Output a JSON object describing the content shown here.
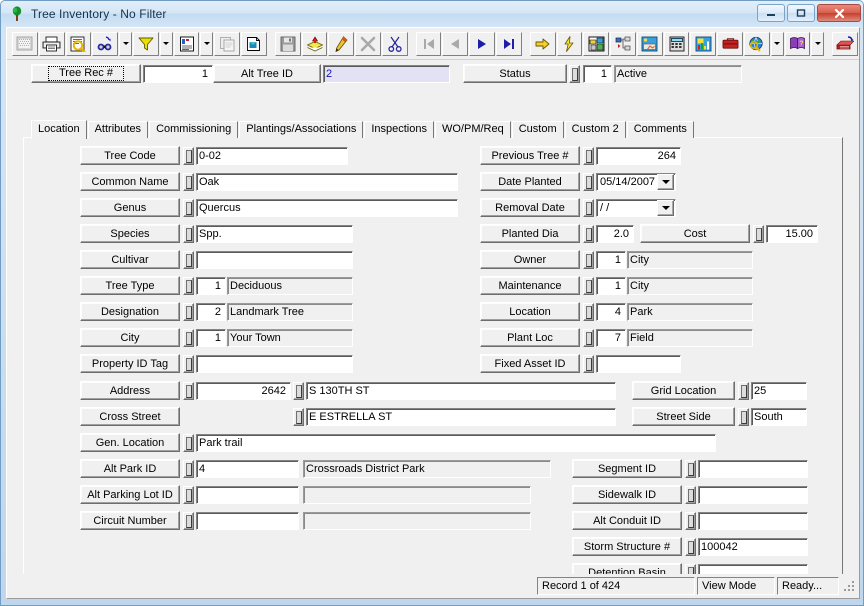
{
  "window": {
    "title": "Tree Inventory - No Filter",
    "icon": "tree-icon",
    "buttons": {
      "minimize": "minimize-icon",
      "maximize": "maximize-icon",
      "close": "close-icon"
    }
  },
  "toolbar": {
    "items": [
      {
        "name": "select-rows-button",
        "icon": "grid-select-icon",
        "enabled": false
      },
      {
        "name": "print-button",
        "icon": "printer-icon",
        "enabled": true
      },
      {
        "name": "print-preview-button",
        "icon": "print-preview-icon",
        "enabled": true
      },
      {
        "name": "find-button",
        "icon": "binoculars-icon",
        "enabled": true
      },
      {
        "name": "find-dropdown",
        "icon": "chevron-down-icon",
        "enabled": true
      },
      {
        "name": "filter-button",
        "icon": "funnel-icon",
        "enabled": true
      },
      {
        "name": "filter-dropdown",
        "icon": "chevron-down-icon",
        "enabled": true
      },
      {
        "name": "report-button",
        "icon": "document-report-icon",
        "enabled": true
      },
      {
        "name": "report-dropdown",
        "icon": "chevron-down-icon",
        "enabled": true
      },
      {
        "name": "copy-record-button",
        "icon": "copy-record-icon",
        "enabled": false
      },
      {
        "name": "duplicate-button",
        "icon": "duplicate-pages-icon",
        "enabled": true
      },
      {
        "name": "save-button",
        "icon": "floppy-save-icon",
        "enabled": false
      },
      {
        "name": "add-record-button",
        "icon": "add-stack-icon",
        "enabled": true
      },
      {
        "name": "edit-record-button",
        "icon": "pencil-edit-icon",
        "enabled": true
      },
      {
        "name": "delete-record-button",
        "icon": "delete-x-icon",
        "enabled": false
      },
      {
        "name": "cut-button",
        "icon": "scissors-icon",
        "enabled": true
      },
      {
        "name": "first-record-button",
        "icon": "first-record-icon",
        "enabled": false
      },
      {
        "name": "previous-record-button",
        "icon": "previous-record-icon",
        "enabled": false
      },
      {
        "name": "next-record-button",
        "icon": "next-record-icon",
        "enabled": true
      },
      {
        "name": "last-record-button",
        "icon": "last-record-icon",
        "enabled": true
      },
      {
        "name": "goto-button",
        "icon": "yellow-arrow-icon",
        "enabled": true
      },
      {
        "name": "quick-action-button",
        "icon": "lightning-bolt-icon",
        "enabled": true
      },
      {
        "name": "map-button",
        "icon": "map-icon",
        "enabled": true
      },
      {
        "name": "hierarchy-button",
        "icon": "tree-structure-icon",
        "enabled": true
      },
      {
        "name": "image-button",
        "icon": "picture-icon",
        "enabled": true
      },
      {
        "name": "calculator-button",
        "icon": "calculator-icon",
        "enabled": true
      },
      {
        "name": "chart-button",
        "icon": "chart-icon",
        "enabled": true
      },
      {
        "name": "toolbox-button",
        "icon": "toolbox-icon",
        "enabled": true
      },
      {
        "name": "web-button",
        "icon": "globe-search-icon",
        "enabled": true
      },
      {
        "name": "web-dropdown",
        "icon": "chevron-down-icon",
        "enabled": true
      },
      {
        "name": "help-button",
        "icon": "book-help-icon",
        "enabled": true
      },
      {
        "name": "help-dropdown",
        "icon": "chevron-down-icon",
        "enabled": true
      },
      {
        "name": "exit-button",
        "icon": "exit-door-icon",
        "enabled": true
      }
    ]
  },
  "header": {
    "tree_rec_label": "Tree Rec #",
    "tree_rec_value": "1",
    "alt_tree_id_label": "Alt Tree ID",
    "alt_tree_id_value": "2",
    "status_label": "Status",
    "status_code": "1",
    "status_text": "Active"
  },
  "tabs": [
    {
      "label": "Location",
      "active": true
    },
    {
      "label": "Attributes",
      "active": false
    },
    {
      "label": "Commissioning",
      "active": false
    },
    {
      "label": "Plantings/Associations",
      "active": false
    },
    {
      "label": "Inspections",
      "active": false
    },
    {
      "label": "WO/PM/Req",
      "active": false
    },
    {
      "label": "Custom",
      "active": false
    },
    {
      "label": "Custom 2",
      "active": false
    },
    {
      "label": "Comments",
      "active": false
    }
  ],
  "left_fields": [
    {
      "label": "Tree Code",
      "code": "",
      "value": "0-02",
      "has_code": false,
      "wide": false
    },
    {
      "label": "Common Name",
      "code": "",
      "value": "Oak",
      "has_code": false,
      "wide": true
    },
    {
      "label": "Genus",
      "code": "",
      "value": "Quercus",
      "has_code": false,
      "wide": true
    },
    {
      "label": "Species",
      "code": "",
      "value": "Spp.",
      "has_code": false,
      "wide": false
    },
    {
      "label": "Cultivar",
      "code": "",
      "value": "",
      "has_code": false,
      "wide": false
    },
    {
      "label": "Tree Type",
      "code": "1",
      "value": "Deciduous",
      "has_code": true,
      "wide": false
    },
    {
      "label": "Designation",
      "code": "2",
      "value": "Landmark Tree",
      "has_code": true,
      "wide": false
    },
    {
      "label": "City",
      "code": "1",
      "value": "Your Town",
      "has_code": true,
      "wide": false
    },
    {
      "label": "Property ID Tag",
      "code": "",
      "value": "",
      "has_code": false,
      "wide": false
    }
  ],
  "right_fields": [
    {
      "label": "Previous Tree #",
      "code": "",
      "value": "264",
      "has_code": false,
      "numeric": true
    },
    {
      "label": "Owner",
      "code": "1",
      "value": "City",
      "has_code": true,
      "numeric": false
    },
    {
      "label": "Maintenance",
      "code": "1",
      "value": "City",
      "has_code": true,
      "numeric": false
    },
    {
      "label": "Location",
      "code": "4",
      "value": "Park",
      "has_code": true,
      "numeric": false
    },
    {
      "label": "Plant Loc",
      "code": "7",
      "value": "Field",
      "has_code": true,
      "numeric": false
    },
    {
      "label": "Fixed Asset ID",
      "code": "",
      "value": "",
      "has_code": false,
      "numeric": false
    }
  ],
  "date_fields": {
    "date_planted_label": "Date Planted",
    "date_planted_value": "05/14/2007",
    "removal_date_label": "Removal Date",
    "removal_date_value": "  /  /"
  },
  "planted": {
    "planted_dia_label": "Planted Dia",
    "planted_dia_value": "2.0",
    "cost_label": "Cost",
    "cost_value": "15.00"
  },
  "address": {
    "address_label": "Address",
    "address_number": "2642",
    "address_street": "S 130TH ST",
    "cross_street_label": "Cross Street",
    "cross_street_value": "E ESTRELLA ST",
    "gen_location_label": "Gen. Location",
    "gen_location_value": "Park trail",
    "grid_location_label": "Grid Location",
    "grid_location_value": "25",
    "street_side_label": "Street Side",
    "street_side_value": "South"
  },
  "park_fields": [
    {
      "label": "Alt Park ID",
      "code": "4",
      "value": "Crossroads District Park"
    },
    {
      "label": "Alt Parking Lot ID",
      "code": "",
      "value": ""
    },
    {
      "label": "Circuit Number",
      "code": "",
      "value": ""
    }
  ],
  "infra_fields": [
    {
      "label": "Segment ID",
      "value": ""
    },
    {
      "label": "Sidewalk ID",
      "value": ""
    },
    {
      "label": "Alt Conduit ID",
      "value": ""
    },
    {
      "label": "Storm Structure #",
      "value": "100042"
    },
    {
      "label": "Detention Basin",
      "value": ""
    }
  ],
  "statusbar": {
    "record": "Record 1 of 424",
    "mode": "View Mode",
    "state": "Ready...",
    "grip": "resize-grip-icon"
  },
  "colors": {
    "window_frame": "#6f9dc6",
    "face": "#f0f0f0",
    "field_bg": "#ffffff",
    "lookup_bg": "#f0f0f0",
    "highlight_bg": "#e2e2f4",
    "highlight_fg": "#1515a8",
    "close_button": "#c2402f"
  }
}
